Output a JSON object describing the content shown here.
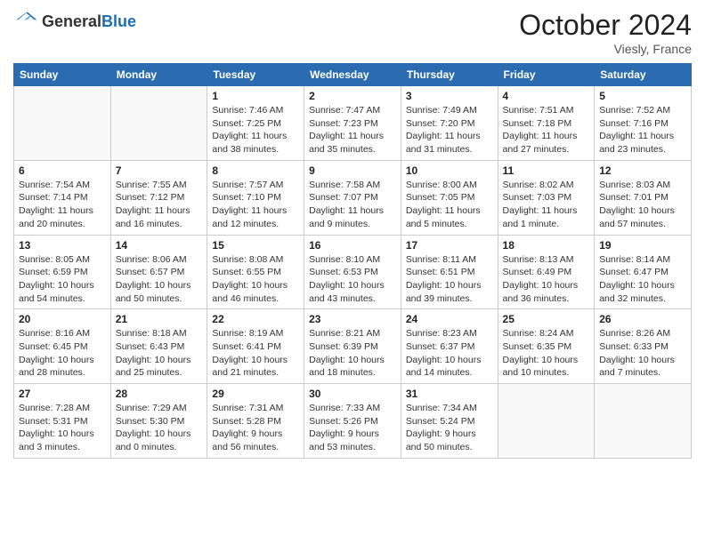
{
  "header": {
    "logo_general": "General",
    "logo_blue": "Blue",
    "month_title": "October 2024",
    "location": "Viesly, France"
  },
  "weekdays": [
    "Sunday",
    "Monday",
    "Tuesday",
    "Wednesday",
    "Thursday",
    "Friday",
    "Saturday"
  ],
  "weeks": [
    [
      {
        "day": "",
        "info": ""
      },
      {
        "day": "",
        "info": ""
      },
      {
        "day": "1",
        "info": "Sunrise: 7:46 AM\nSunset: 7:25 PM\nDaylight: 11 hours and 38 minutes."
      },
      {
        "day": "2",
        "info": "Sunrise: 7:47 AM\nSunset: 7:23 PM\nDaylight: 11 hours and 35 minutes."
      },
      {
        "day": "3",
        "info": "Sunrise: 7:49 AM\nSunset: 7:20 PM\nDaylight: 11 hours and 31 minutes."
      },
      {
        "day": "4",
        "info": "Sunrise: 7:51 AM\nSunset: 7:18 PM\nDaylight: 11 hours and 27 minutes."
      },
      {
        "day": "5",
        "info": "Sunrise: 7:52 AM\nSunset: 7:16 PM\nDaylight: 11 hours and 23 minutes."
      }
    ],
    [
      {
        "day": "6",
        "info": "Sunrise: 7:54 AM\nSunset: 7:14 PM\nDaylight: 11 hours and 20 minutes."
      },
      {
        "day": "7",
        "info": "Sunrise: 7:55 AM\nSunset: 7:12 PM\nDaylight: 11 hours and 16 minutes."
      },
      {
        "day": "8",
        "info": "Sunrise: 7:57 AM\nSunset: 7:10 PM\nDaylight: 11 hours and 12 minutes."
      },
      {
        "day": "9",
        "info": "Sunrise: 7:58 AM\nSunset: 7:07 PM\nDaylight: 11 hours and 9 minutes."
      },
      {
        "day": "10",
        "info": "Sunrise: 8:00 AM\nSunset: 7:05 PM\nDaylight: 11 hours and 5 minutes."
      },
      {
        "day": "11",
        "info": "Sunrise: 8:02 AM\nSunset: 7:03 PM\nDaylight: 11 hours and 1 minute."
      },
      {
        "day": "12",
        "info": "Sunrise: 8:03 AM\nSunset: 7:01 PM\nDaylight: 10 hours and 57 minutes."
      }
    ],
    [
      {
        "day": "13",
        "info": "Sunrise: 8:05 AM\nSunset: 6:59 PM\nDaylight: 10 hours and 54 minutes."
      },
      {
        "day": "14",
        "info": "Sunrise: 8:06 AM\nSunset: 6:57 PM\nDaylight: 10 hours and 50 minutes."
      },
      {
        "day": "15",
        "info": "Sunrise: 8:08 AM\nSunset: 6:55 PM\nDaylight: 10 hours and 46 minutes."
      },
      {
        "day": "16",
        "info": "Sunrise: 8:10 AM\nSunset: 6:53 PM\nDaylight: 10 hours and 43 minutes."
      },
      {
        "day": "17",
        "info": "Sunrise: 8:11 AM\nSunset: 6:51 PM\nDaylight: 10 hours and 39 minutes."
      },
      {
        "day": "18",
        "info": "Sunrise: 8:13 AM\nSunset: 6:49 PM\nDaylight: 10 hours and 36 minutes."
      },
      {
        "day": "19",
        "info": "Sunrise: 8:14 AM\nSunset: 6:47 PM\nDaylight: 10 hours and 32 minutes."
      }
    ],
    [
      {
        "day": "20",
        "info": "Sunrise: 8:16 AM\nSunset: 6:45 PM\nDaylight: 10 hours and 28 minutes."
      },
      {
        "day": "21",
        "info": "Sunrise: 8:18 AM\nSunset: 6:43 PM\nDaylight: 10 hours and 25 minutes."
      },
      {
        "day": "22",
        "info": "Sunrise: 8:19 AM\nSunset: 6:41 PM\nDaylight: 10 hours and 21 minutes."
      },
      {
        "day": "23",
        "info": "Sunrise: 8:21 AM\nSunset: 6:39 PM\nDaylight: 10 hours and 18 minutes."
      },
      {
        "day": "24",
        "info": "Sunrise: 8:23 AM\nSunset: 6:37 PM\nDaylight: 10 hours and 14 minutes."
      },
      {
        "day": "25",
        "info": "Sunrise: 8:24 AM\nSunset: 6:35 PM\nDaylight: 10 hours and 10 minutes."
      },
      {
        "day": "26",
        "info": "Sunrise: 8:26 AM\nSunset: 6:33 PM\nDaylight: 10 hours and 7 minutes."
      }
    ],
    [
      {
        "day": "27",
        "info": "Sunrise: 7:28 AM\nSunset: 5:31 PM\nDaylight: 10 hours and 3 minutes."
      },
      {
        "day": "28",
        "info": "Sunrise: 7:29 AM\nSunset: 5:30 PM\nDaylight: 10 hours and 0 minutes."
      },
      {
        "day": "29",
        "info": "Sunrise: 7:31 AM\nSunset: 5:28 PM\nDaylight: 9 hours and 56 minutes."
      },
      {
        "day": "30",
        "info": "Sunrise: 7:33 AM\nSunset: 5:26 PM\nDaylight: 9 hours and 53 minutes."
      },
      {
        "day": "31",
        "info": "Sunrise: 7:34 AM\nSunset: 5:24 PM\nDaylight: 9 hours and 50 minutes."
      },
      {
        "day": "",
        "info": ""
      },
      {
        "day": "",
        "info": ""
      }
    ]
  ]
}
